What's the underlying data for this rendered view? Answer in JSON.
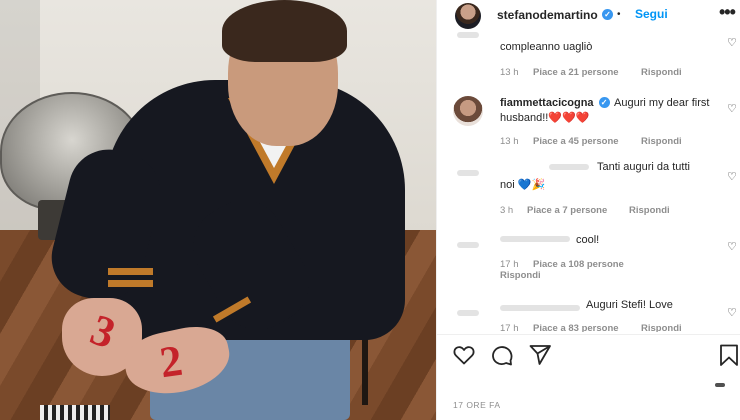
{
  "post": {
    "username": "stefanodemartino",
    "verified_mark": "✓",
    "dot": "•",
    "follow_label": "Segui",
    "more_label": "•••",
    "timestamp": "17 ORE FA",
    "photo_numbers": [
      "3",
      "2"
    ]
  },
  "comments": [
    {
      "text": "compleanno uagliò",
      "age": "13 h",
      "likes": "Piace a 21 persone",
      "reply": "Rispondi"
    },
    {
      "username": "fiammettacicogna",
      "verified_mark": "✓",
      "text": "Auguri my dear first husband!!",
      "hearts": "❤️❤️❤️",
      "age": "13 h",
      "likes": "Piace a 45 persone",
      "reply": "Rispondi"
    },
    {
      "text_line1": "Tanti auguri da tutti",
      "text_line2": "noi",
      "emoji_heart": "💙",
      "emoji_party": "🎉",
      "age": "3 h",
      "likes": "Piace a 7 persone",
      "reply": "Rispondi"
    },
    {
      "text": "cool!",
      "age": "17 h",
      "likes": "Piace a 108 persone",
      "reply": "Rispondi"
    },
    {
      "text": "Auguri Stefi! Love",
      "age": "17 h",
      "likes": "Piace a 83 persone",
      "reply": "Rispondi"
    }
  ],
  "icons": {
    "like": "heart-icon",
    "comment": "comment-icon",
    "share": "share-icon",
    "save": "bookmark-icon"
  },
  "colors": {
    "link": "#0095f6",
    "verified": "#3897f0",
    "meta": "#8e8e8e"
  }
}
